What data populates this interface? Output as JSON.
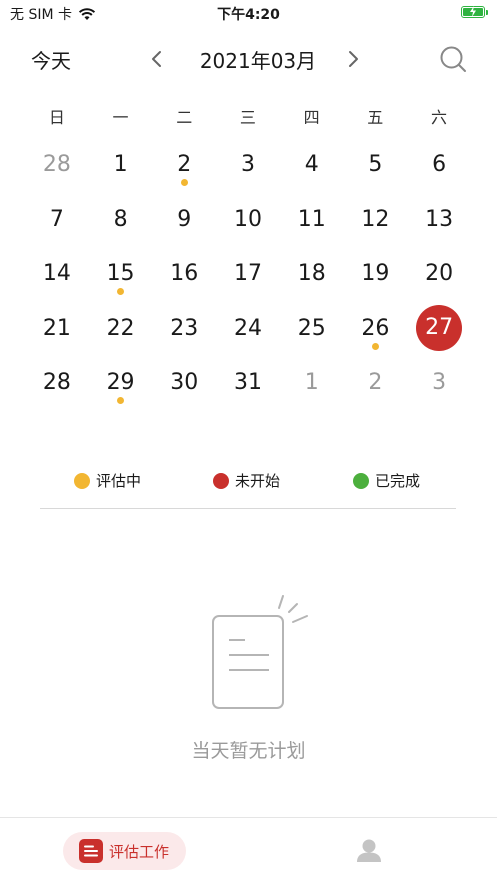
{
  "status_bar": {
    "carrier": "无 SIM 卡",
    "time": "下午4:20"
  },
  "header": {
    "today_label": "今天",
    "month_title": "2021年03月",
    "icons": [
      "chevron-left-icon",
      "chevron-right-icon",
      "search-icon"
    ]
  },
  "weekdays": [
    "日",
    "一",
    "二",
    "三",
    "四",
    "五",
    "六"
  ],
  "calendar": {
    "days": [
      {
        "label": "28",
        "muted": true,
        "dot": false,
        "selected": false
      },
      {
        "label": "1",
        "muted": false,
        "dot": false,
        "selected": false
      },
      {
        "label": "2",
        "muted": false,
        "dot": true,
        "selected": false
      },
      {
        "label": "3",
        "muted": false,
        "dot": false,
        "selected": false
      },
      {
        "label": "4",
        "muted": false,
        "dot": false,
        "selected": false
      },
      {
        "label": "5",
        "muted": false,
        "dot": false,
        "selected": false
      },
      {
        "label": "6",
        "muted": false,
        "dot": false,
        "selected": false
      },
      {
        "label": "7",
        "muted": false,
        "dot": false,
        "selected": false
      },
      {
        "label": "8",
        "muted": false,
        "dot": false,
        "selected": false
      },
      {
        "label": "9",
        "muted": false,
        "dot": false,
        "selected": false
      },
      {
        "label": "10",
        "muted": false,
        "dot": false,
        "selected": false
      },
      {
        "label": "11",
        "muted": false,
        "dot": false,
        "selected": false
      },
      {
        "label": "12",
        "muted": false,
        "dot": false,
        "selected": false
      },
      {
        "label": "13",
        "muted": false,
        "dot": false,
        "selected": false
      },
      {
        "label": "14",
        "muted": false,
        "dot": false,
        "selected": false
      },
      {
        "label": "15",
        "muted": false,
        "dot": true,
        "selected": false
      },
      {
        "label": "16",
        "muted": false,
        "dot": false,
        "selected": false
      },
      {
        "label": "17",
        "muted": false,
        "dot": false,
        "selected": false
      },
      {
        "label": "18",
        "muted": false,
        "dot": false,
        "selected": false
      },
      {
        "label": "19",
        "muted": false,
        "dot": false,
        "selected": false
      },
      {
        "label": "20",
        "muted": false,
        "dot": false,
        "selected": false
      },
      {
        "label": "21",
        "muted": false,
        "dot": false,
        "selected": false
      },
      {
        "label": "22",
        "muted": false,
        "dot": false,
        "selected": false
      },
      {
        "label": "23",
        "muted": false,
        "dot": false,
        "selected": false
      },
      {
        "label": "24",
        "muted": false,
        "dot": false,
        "selected": false
      },
      {
        "label": "25",
        "muted": false,
        "dot": false,
        "selected": false
      },
      {
        "label": "26",
        "muted": false,
        "dot": true,
        "selected": false
      },
      {
        "label": "27",
        "muted": false,
        "dot": false,
        "selected": true
      },
      {
        "label": "28",
        "muted": false,
        "dot": false,
        "selected": false
      },
      {
        "label": "29",
        "muted": false,
        "dot": true,
        "selected": false
      },
      {
        "label": "30",
        "muted": false,
        "dot": false,
        "selected": false
      },
      {
        "label": "31",
        "muted": false,
        "dot": false,
        "selected": false
      },
      {
        "label": "1",
        "muted": true,
        "dot": false,
        "selected": false
      },
      {
        "label": "2",
        "muted": true,
        "dot": false,
        "selected": false
      },
      {
        "label": "3",
        "muted": true,
        "dot": false,
        "selected": false
      }
    ]
  },
  "legend": [
    {
      "label": "评估中",
      "color": "#f2b632"
    },
    {
      "label": "未开始",
      "color": "#c9302c"
    },
    {
      "label": "已完成",
      "color": "#4caf3d"
    }
  ],
  "empty_state": {
    "text": "当天暂无计划",
    "icon": "document-icon"
  },
  "tabbar": {
    "work_label": "评估工作",
    "work_icon": "menu-list-icon",
    "user_icon": "user-icon"
  },
  "colors": {
    "accent": "#c9302c",
    "accent_light": "#fbe9ea",
    "dot": "#f2b632",
    "muted_text": "#9a9a9a"
  }
}
